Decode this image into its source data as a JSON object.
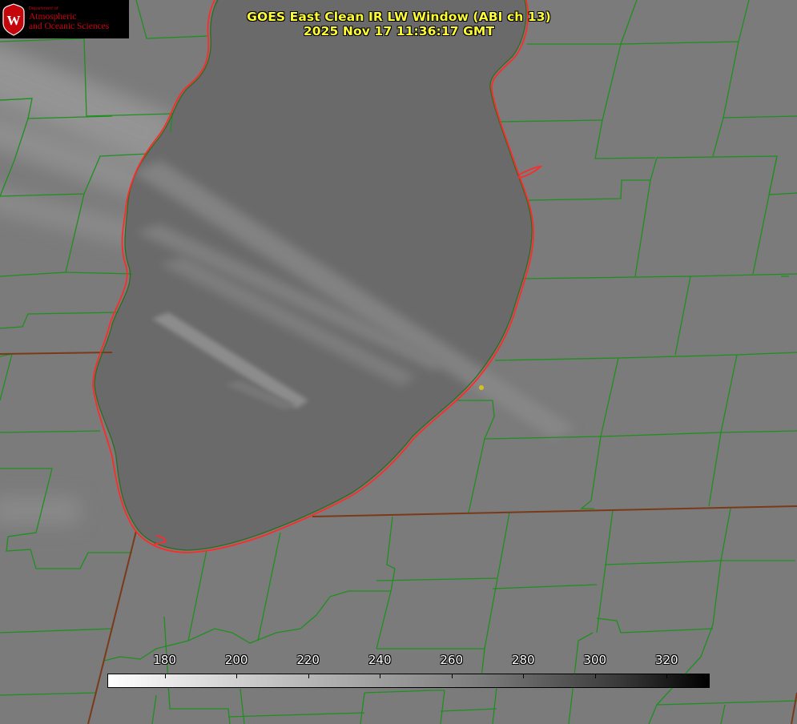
{
  "title": {
    "line1": "GOES East Clean IR LW Window (ABI ch 13)",
    "line2": "2025 Nov 17 11:36:17 GMT"
  },
  "logo": {
    "dept": "Department of",
    "line1": "Atmospheric",
    "line2": "and Oceanic Sciences",
    "crest_letter": "W",
    "color": "#c5050c"
  },
  "colorbar": {
    "labels": [
      {
        "text": "180",
        "value": 180
      },
      {
        "text": "200",
        "value": 200
      },
      {
        "text": "220",
        "value": 220
      },
      {
        "text": "240",
        "value": 240
      },
      {
        "text": "260",
        "value": 260
      },
      {
        "text": "280",
        "value": 280
      },
      {
        "text": "300",
        "value": 300
      },
      {
        "text": "320",
        "value": 320
      }
    ],
    "min": 164,
    "max": 332,
    "colors": [
      "#ffffff",
      "#000000"
    ]
  },
  "colors": {
    "county_lines": "#1f8f1f",
    "state_lines": "#7a3a1a",
    "lake_outline": "#ff2a2a",
    "station_marker": "#d4c31a",
    "title_text": "#ffff33",
    "lake_fill": "#6a6a6a",
    "land_fill": "#7b7b7b"
  }
}
